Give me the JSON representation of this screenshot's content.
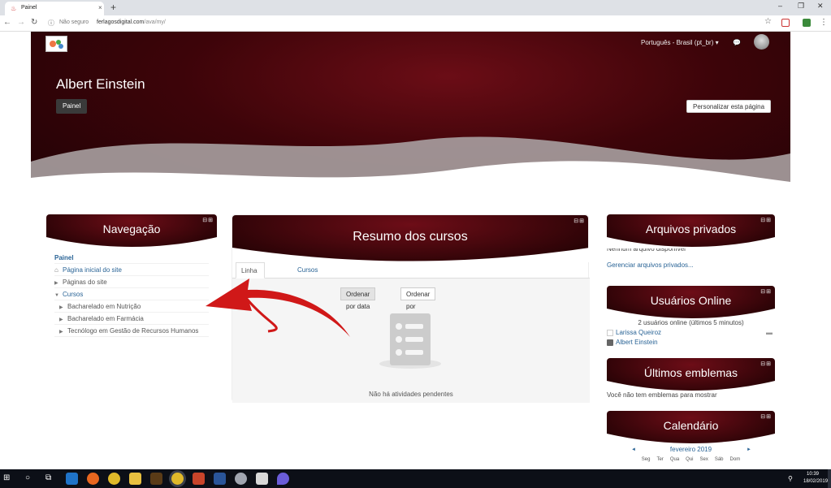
{
  "browser": {
    "tab_title": "Painel",
    "tab_close": "×",
    "new_tab": "+",
    "security": "Não seguro",
    "url_host": "ferlagosdigital.com",
    "url_path": "/ava/my/",
    "win_min": "–",
    "win_restore": "❐",
    "win_close": "✕"
  },
  "header": {
    "language": "Português - Brasil (pt_br) ▾",
    "page_title": "Albert Einstein",
    "breadcrumb": "Painel",
    "customize_button": "Personalizar esta página"
  },
  "navigation": {
    "title": "Navegação",
    "items": [
      {
        "label": "Painel",
        "level": 0
      },
      {
        "label": "Página inicial do site",
        "level": 0
      },
      {
        "label": "Páginas do site",
        "level": 0
      },
      {
        "label": "Cursos",
        "level": 0
      },
      {
        "label": "Bacharelado em Nutrição",
        "level": 1
      },
      {
        "label": "Bacharelado em Farmácia",
        "level": 1
      },
      {
        "label": "Tecnólogo em Gestão de Recursos Humanos",
        "level": 1
      }
    ]
  },
  "course_overview": {
    "title": "Resumo dos cursos",
    "tab_timeline": "Linha do tempo",
    "tab_courses": "Cursos",
    "btn_sort_date": "Ordenar por data",
    "btn_sort_courses": "Ordenar por cursos",
    "empty_text": "Não há atividades pendentes"
  },
  "private_files": {
    "title": "Arquivos privados",
    "empty_text": "Nenhum arquivo disponível",
    "manage_link": "Gerenciar arquivos privados..."
  },
  "online_users": {
    "title": "Usuários Online",
    "summary": "2 usuários online (últimos 5 minutos)",
    "users": [
      "Larissa Queiroz",
      "Albert Einstein"
    ]
  },
  "badges": {
    "title": "Últimos emblemas",
    "empty_text": "Você não tem emblemas para mostrar"
  },
  "calendar": {
    "title": "Calendário",
    "month": "fevereiro 2019",
    "prev": "◄",
    "next": "►",
    "weekdays": [
      "Seg",
      "Ter",
      "Qua",
      "Qui",
      "Sex",
      "Sáb",
      "Dom"
    ]
  },
  "taskbar": {
    "time": "10:39",
    "date": "18/02/2019"
  },
  "colors": {
    "brand_dark_red": "#3d0409",
    "link_blue": "#2a6496",
    "arrow_red": "#d01818"
  }
}
